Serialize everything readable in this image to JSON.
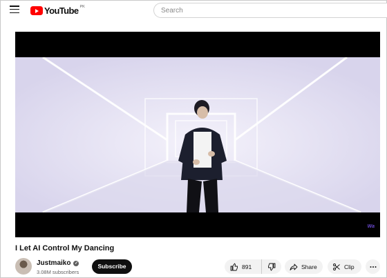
{
  "header": {
    "logo_text": "YouTube",
    "country_code": "PK",
    "search_placeholder": "Search"
  },
  "video": {
    "title": "I Let AI Control My Dancing",
    "watermark": "Wa"
  },
  "channel": {
    "name": "Justmaiko",
    "subscribers": "3.08M subscribers",
    "subscribe_label": "Subscribe"
  },
  "actions": {
    "like_count": "891",
    "share_label": "Share",
    "clip_label": "Clip"
  },
  "colors": {
    "brand_red": "#ff0000",
    "subscribe_bg": "#0f0f0f",
    "pill_bg": "#f2f2f2"
  }
}
